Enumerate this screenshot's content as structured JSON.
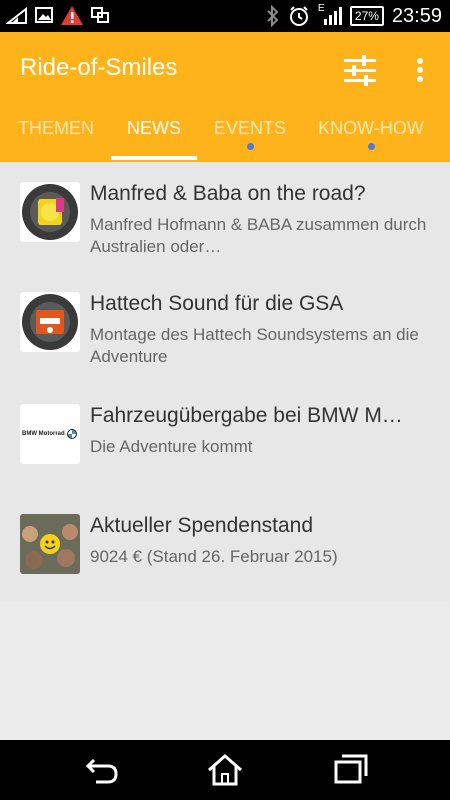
{
  "status_bar": {
    "battery": "27%",
    "network": "E",
    "time": "23:59"
  },
  "app": {
    "title": "Ride-of-Smiles"
  },
  "tabs": [
    {
      "label": "THEMEN",
      "active": false,
      "dot": false
    },
    {
      "label": "NEWS",
      "active": true,
      "dot": false
    },
    {
      "label": "EVENTS",
      "active": false,
      "dot": true
    },
    {
      "label": "KNOW-HOW",
      "active": false,
      "dot": true
    }
  ],
  "news": [
    {
      "title": "Manfred & Baba on the road?",
      "subtitle": "Manfred Hofmann & BABA zusammen durch Australien oder…",
      "thumb": "ride-of-smiles-sticker-yellow"
    },
    {
      "title": "Hattech Sound für die GSA",
      "subtitle": "Montage des Hattech Soundsystems an die Adventure",
      "thumb": "ride-of-smiles-sticker-orange"
    },
    {
      "title": "Fahrzeugübergabe bei BMW M…",
      "subtitle": "Die Adventure kommt",
      "thumb": "bmw-motorrad-logo",
      "thumb_text": "BMW Motorrad"
    },
    {
      "title": "Aktueller Spendenstand",
      "subtitle": "9024 € (Stand 26. Februar 2015)",
      "thumb": "group-photo"
    }
  ],
  "colors": {
    "app_bar": "#ffb31a",
    "tab_dot": "#4d7bd8",
    "list_bg": "#e7e7e7"
  }
}
